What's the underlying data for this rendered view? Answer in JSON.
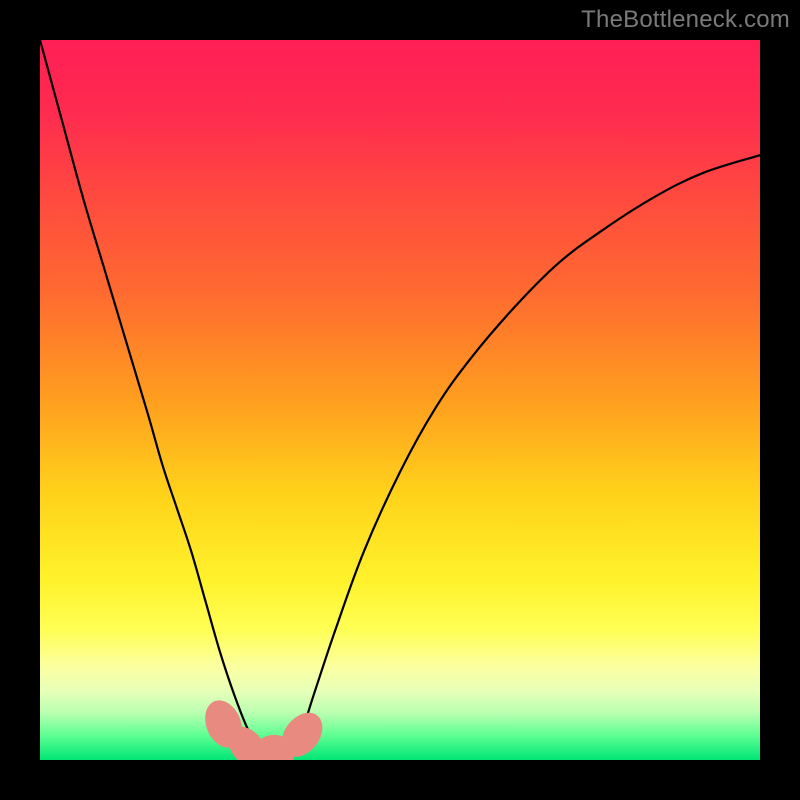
{
  "watermark": "TheBottleneck.com",
  "chart_data": {
    "type": "line",
    "title": "",
    "xlabel": "",
    "ylabel": "",
    "xlim": [
      0,
      100
    ],
    "ylim": [
      0,
      100
    ],
    "grid": false,
    "legend": false,
    "background_gradient": {
      "stops": [
        {
          "offset": 0.0,
          "color": "#ff1f55"
        },
        {
          "offset": 0.1,
          "color": "#ff2b4f"
        },
        {
          "offset": 0.22,
          "color": "#ff4a3f"
        },
        {
          "offset": 0.35,
          "color": "#ff6a30"
        },
        {
          "offset": 0.5,
          "color": "#ff9e1f"
        },
        {
          "offset": 0.63,
          "color": "#ffd21a"
        },
        {
          "offset": 0.75,
          "color": "#fff22b"
        },
        {
          "offset": 0.82,
          "color": "#ffff55"
        },
        {
          "offset": 0.87,
          "color": "#fcffa0"
        },
        {
          "offset": 0.905,
          "color": "#e6ffb8"
        },
        {
          "offset": 0.935,
          "color": "#b8ffb0"
        },
        {
          "offset": 0.965,
          "color": "#61ff93"
        },
        {
          "offset": 1.0,
          "color": "#00e676"
        }
      ]
    },
    "series": [
      {
        "name": "bottleneck-curve",
        "color": "#000000",
        "x": [
          0,
          3,
          6,
          9,
          12,
          15,
          17,
          19,
          21,
          23,
          25,
          27,
          29,
          31,
          32.5,
          34,
          36,
          38,
          41,
          45,
          50,
          55,
          60,
          66,
          72,
          78,
          85,
          92,
          100
        ],
        "y": [
          100,
          89,
          78,
          68,
          58,
          48,
          41,
          35,
          29,
          22,
          15,
          9,
          4,
          1,
          0,
          0.5,
          3,
          9,
          18,
          29,
          40,
          49,
          56,
          63,
          69,
          73.5,
          78,
          81.5,
          84
        ]
      }
    ],
    "markers": [
      {
        "name": "floor-marker",
        "x": 25.5,
        "y": 5.0,
        "rx": 2.4,
        "ry": 3.4,
        "angle": -22,
        "color": "#e98a80"
      },
      {
        "name": "floor-marker",
        "x": 28.8,
        "y": 1.8,
        "rx": 2.2,
        "ry": 3.2,
        "angle": -40,
        "color": "#e98a80"
      },
      {
        "name": "floor-marker",
        "x": 32.5,
        "y": 0.9,
        "rx": 2.8,
        "ry": 2.6,
        "angle": 0,
        "color": "#e98a80"
      },
      {
        "name": "floor-marker",
        "x": 36.4,
        "y": 3.5,
        "rx": 2.4,
        "ry": 3.4,
        "angle": 38,
        "color": "#e98a80"
      }
    ]
  }
}
